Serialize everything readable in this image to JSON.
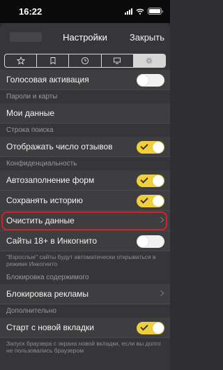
{
  "status_bar": {
    "time": "16:22"
  },
  "header": {
    "title": "Настройки",
    "close_label": "Закрыть"
  },
  "tabs": [
    {
      "icon": "star-icon",
      "active": false
    },
    {
      "icon": "bookmarks-icon",
      "active": false
    },
    {
      "icon": "clock-icon",
      "active": false
    },
    {
      "icon": "monitor-icon",
      "active": false
    },
    {
      "icon": "gear-icon",
      "active": true
    }
  ],
  "settings": {
    "voice_activation": {
      "label": "Голосовая активация",
      "enabled": false
    },
    "passwords_section": "Пароли и карты",
    "my_data": {
      "label": "Мои данные"
    },
    "search_section": "Строка поиска",
    "show_reviews": {
      "label": "Отображать число отзывов",
      "enabled": true
    },
    "privacy_section": "Конфиденциальность",
    "autofill": {
      "label": "Автозаполнение форм",
      "enabled": true
    },
    "save_history": {
      "label": "Сохранять историю",
      "enabled": true
    },
    "clear_data": {
      "label": "Очистить данные"
    },
    "adult_incognito": {
      "label": "Сайты 18+ в Инкогнито",
      "enabled": false
    },
    "adult_note": "\"Взрослые\" сайты будут автоматически открываться в режиме Инкогнито",
    "content_block_section": "Блокировка содержимого",
    "ad_block": {
      "label": "Блокировка рекламы"
    },
    "extra_section": "Дополнительно",
    "new_tab_start": {
      "label": "Старт с новой вкладки",
      "enabled": true
    },
    "new_tab_note": "Запуск браузера с экрана новой вкладки, если вы долго не пользовались браузером"
  },
  "colors": {
    "toggle_on": "#f0cf3c",
    "highlight": "#d8202a"
  }
}
